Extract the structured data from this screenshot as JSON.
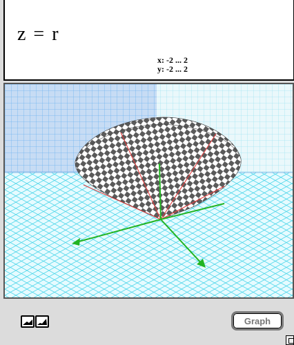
{
  "equation": {
    "text": "z = r"
  },
  "ranges": {
    "x": "x: -2 ... 2",
    "y": "y: -2 ... 2"
  },
  "buttons": {
    "graph_label": "Graph"
  },
  "colors": {
    "grid": "#3fd0e8",
    "wall_grid": "#5ab0ee",
    "axis": "#22b422",
    "radial_lines": "#e23c3c",
    "checker_dark": "#5a5a5a",
    "checker_light": "#ffffff"
  },
  "icons": [
    "surface-shape-1-icon",
    "surface-shape-2-icon",
    "resize-grip-icon"
  ]
}
